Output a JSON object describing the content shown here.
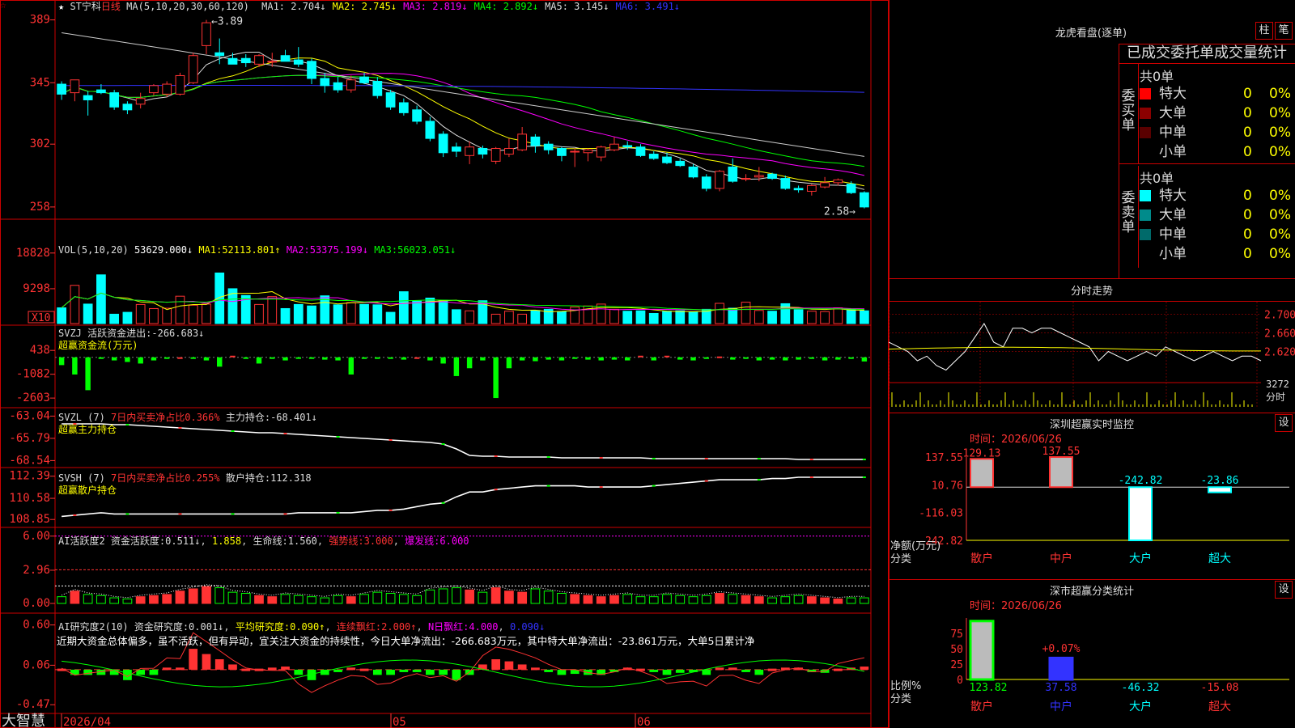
{
  "app": {
    "name": "大智慧"
  },
  "stock": {
    "star": "★",
    "arrow_glyph": "☆",
    "name": "ST宁科",
    "period": "日线",
    "ma_label": "MA(5,10,20,30,60,120)",
    "mas": [
      {
        "label": "MA1:",
        "value": "2.704↓",
        "color": "#dddddd"
      },
      {
        "label": "MA2:",
        "value": "2.745↓",
        "color": "#ffff00"
      },
      {
        "label": "MA3:",
        "value": "2.819↓",
        "color": "#ff00ff"
      },
      {
        "label": "MA4:",
        "value": "2.892↓",
        "color": "#00ff00"
      },
      {
        "label": "MA5:",
        "value": "3.145↓",
        "color": "#dddddd"
      },
      {
        "label": "MA6:",
        "value": "3.491↓",
        "color": "#3333ff"
      }
    ],
    "high_marker": "3.89",
    "low_marker": "2.58"
  },
  "axes": {
    "price": [
      "389",
      "345",
      "302",
      "258"
    ],
    "volume": [
      "18828",
      "9298",
      "X10"
    ],
    "svzj": [
      "438",
      "-1082",
      "-2603"
    ],
    "svzl": [
      "-63.04",
      "-65.79",
      "-68.54"
    ],
    "svsh": [
      "112.39",
      "110.58",
      "108.85"
    ],
    "ai1": [
      "6.00",
      "2.96",
      "0.00"
    ],
    "ai2": [
      "0.60",
      "0.06",
      "-0.47"
    ],
    "dates": [
      "2026/04",
      "05",
      "06"
    ]
  },
  "chart_data": [
    {
      "type": "candlestick",
      "title": "ST宁科 日线",
      "ylim": [
        2.5,
        3.95
      ],
      "yticks": [
        3.89,
        3.45,
        3.02,
        2.58
      ],
      "note": "approximate",
      "candles": [
        [
          3.44,
          3.46,
          3.33,
          3.37
        ],
        [
          3.38,
          3.47,
          3.32,
          3.47
        ],
        [
          3.36,
          3.39,
          3.22,
          3.33
        ],
        [
          3.4,
          3.44,
          3.37,
          3.38
        ],
        [
          3.38,
          3.4,
          3.26,
          3.28
        ],
        [
          3.3,
          3.32,
          3.23,
          3.26
        ],
        [
          3.3,
          3.38,
          3.27,
          3.34
        ],
        [
          3.38,
          3.44,
          3.36,
          3.43
        ],
        [
          3.37,
          3.46,
          3.35,
          3.44
        ],
        [
          3.37,
          3.52,
          3.36,
          3.5
        ],
        [
          3.45,
          3.66,
          3.44,
          3.64
        ],
        [
          3.71,
          3.89,
          3.65,
          3.87
        ],
        [
          3.66,
          3.76,
          3.58,
          3.64
        ],
        [
          3.62,
          3.66,
          3.58,
          3.58
        ],
        [
          3.62,
          3.65,
          3.56,
          3.59
        ],
        [
          3.58,
          3.65,
          3.56,
          3.64
        ],
        [
          3.6,
          3.66,
          3.56,
          3.6
        ],
        [
          3.64,
          3.68,
          3.6,
          3.6
        ],
        [
          3.61,
          3.7,
          3.56,
          3.58
        ],
        [
          3.6,
          3.62,
          3.44,
          3.48
        ],
        [
          3.48,
          3.52,
          3.38,
          3.43
        ],
        [
          3.45,
          3.49,
          3.38,
          3.4
        ],
        [
          3.4,
          3.5,
          3.38,
          3.47
        ],
        [
          3.49,
          3.52,
          3.44,
          3.45
        ],
        [
          3.46,
          3.49,
          3.34,
          3.36
        ],
        [
          3.38,
          3.4,
          3.26,
          3.28
        ],
        [
          3.31,
          3.34,
          3.22,
          3.24
        ],
        [
          3.26,
          3.29,
          3.16,
          3.18
        ],
        [
          3.18,
          3.21,
          3.04,
          3.06
        ],
        [
          3.09,
          3.11,
          2.93,
          2.96
        ],
        [
          3.0,
          3.03,
          2.93,
          2.97
        ],
        [
          2.94,
          3.04,
          2.88,
          3.0
        ],
        [
          2.99,
          3.01,
          2.92,
          2.95
        ],
        [
          2.9,
          3.0,
          2.88,
          2.99
        ],
        [
          2.95,
          3.06,
          2.93,
          2.99
        ],
        [
          2.98,
          3.14,
          2.97,
          3.09
        ],
        [
          3.07,
          3.09,
          2.96,
          3.01
        ],
        [
          3.02,
          3.04,
          2.95,
          2.98
        ],
        [
          2.99,
          3.0,
          2.9,
          2.94
        ],
        [
          2.97,
          2.99,
          2.86,
          2.97
        ],
        [
          2.96,
          2.99,
          2.9,
          2.98
        ],
        [
          2.93,
          3.01,
          2.9,
          3.0
        ],
        [
          2.98,
          3.07,
          2.97,
          3.02
        ],
        [
          3.01,
          3.04,
          2.98,
          3.0
        ],
        [
          3.0,
          3.02,
          2.93,
          2.94
        ],
        [
          2.95,
          2.97,
          2.91,
          2.92
        ],
        [
          2.93,
          2.96,
          2.88,
          2.89
        ],
        [
          2.9,
          2.92,
          2.86,
          2.87
        ],
        [
          2.86,
          2.88,
          2.78,
          2.79
        ],
        [
          2.79,
          2.81,
          2.69,
          2.71
        ],
        [
          2.71,
          2.84,
          2.69,
          2.83
        ],
        [
          2.86,
          2.92,
          2.75,
          2.76
        ],
        [
          2.78,
          2.81,
          2.76,
          2.78
        ],
        [
          2.79,
          2.86,
          2.76,
          2.8
        ],
        [
          2.81,
          2.82,
          2.77,
          2.78
        ],
        [
          2.78,
          2.8,
          2.7,
          2.71
        ],
        [
          2.71,
          2.73,
          2.68,
          2.7
        ],
        [
          2.69,
          2.74,
          2.66,
          2.73
        ],
        [
          2.72,
          2.79,
          2.71,
          2.75
        ],
        [
          2.75,
          2.78,
          2.73,
          2.77
        ],
        [
          2.74,
          2.76,
          2.67,
          2.68
        ],
        [
          2.68,
          2.69,
          2.57,
          2.58
        ]
      ]
    },
    {
      "type": "bar",
      "title": "VOL(5,10,20)",
      "series": [
        {
          "name": "MA1:",
          "value": "52113.801↑"
        },
        {
          "name": "MA2:",
          "value": "53375.199↓"
        },
        {
          "name": "MA3:",
          "value": "56023.051↓"
        }
      ],
      "value_label": "53629.000↓",
      "note": "approximate",
      "values": [
        4200,
        10200,
        5200,
        13000,
        2500,
        3000,
        5100,
        4000,
        4100,
        7300,
        4900,
        5200,
        13500,
        9300,
        7500,
        5100,
        7200,
        4000,
        5100,
        4700,
        7400,
        5000,
        5600,
        5100,
        5000,
        3000,
        8500,
        6000,
        6800,
        6200,
        3700,
        3400,
        6100,
        2500,
        3300,
        2500,
        3500,
        3800,
        3200,
        4400,
        4700,
        5200,
        3800,
        3300,
        3400,
        2700,
        3300,
        3400,
        3100,
        3800,
        5400,
        4100,
        5700,
        3500,
        3300,
        5300,
        3700,
        3300,
        3200,
        4200,
        3700,
        3400
      ]
    },
    {
      "type": "bar",
      "title": "SVZJ",
      "series": [
        {
          "name": "活跃资金进出:",
          "value": "-266.683↓"
        }
      ],
      "subtitle": "超赢资金流(万元)",
      "note": "approximate",
      "values": [
        -500,
        -1100,
        -2100,
        -100,
        -200,
        -300,
        -400,
        -200,
        -100,
        0,
        -100,
        -200,
        -600,
        100,
        -100,
        -400,
        -100,
        -200,
        -100,
        -100,
        -150,
        -200,
        -1100,
        -100,
        -100,
        -50,
        -150,
        0,
        -200,
        -400,
        -1200,
        -700,
        -200,
        -2600,
        -700,
        -200,
        -250,
        -150,
        -200,
        -100,
        -150,
        -200,
        -150,
        -200,
        100,
        -200,
        100,
        -150,
        -200,
        -100,
        50,
        -150,
        -100,
        -200,
        -150,
        -200,
        -150,
        -100,
        -200,
        -150,
        -100,
        -266
      ]
    },
    {
      "type": "line",
      "title": "SVZL (7)",
      "series": [
        {
          "name": "主力持仓:",
          "value": "-68.401↓"
        }
      ],
      "subtitle": "7日内买卖净占比0.366%",
      "sub2": "超赢主力持仓",
      "ylim": [
        -68.8,
        -62.8
      ],
      "note": "approximate",
      "values": [
        -64.0,
        -64.0,
        -64.0,
        -64.0,
        -64.1,
        -64.1,
        -64.2,
        -64.3,
        -64.4,
        -64.5,
        -64.6,
        -64.7,
        -64.8,
        -64.9,
        -65.0,
        -65.1,
        -65.1,
        -65.2,
        -65.3,
        -65.4,
        -65.5,
        -65.6,
        -65.7,
        -65.8,
        -65.9,
        -66.0,
        -66.1,
        -66.2,
        -66.3,
        -66.5,
        -67.1,
        -67.9,
        -68.0,
        -68.0,
        -68.1,
        -68.1,
        -68.1,
        -68.1,
        -68.2,
        -68.2,
        -68.2,
        -68.2,
        -68.2,
        -68.2,
        -68.2,
        -68.3,
        -68.3,
        -68.3,
        -68.3,
        -68.3,
        -68.3,
        -68.3,
        -68.3,
        -68.3,
        -68.3,
        -68.3,
        -68.4,
        -68.4,
        -68.4,
        -68.4,
        -68.4,
        -68.4
      ]
    },
    {
      "type": "line",
      "title": "SVSH (7)",
      "series": [
        {
          "name": "散户持仓:",
          "value": "112.318"
        }
      ],
      "subtitle": "7日内买卖净占比0.255%",
      "sub2": "超赢散户持仓",
      "ylim": [
        108.6,
        112.7
      ],
      "note": "approximate",
      "values": [
        109.1,
        109.2,
        109.3,
        109.4,
        109.3,
        109.3,
        109.3,
        109.3,
        109.3,
        109.3,
        109.3,
        109.3,
        109.3,
        109.3,
        109.3,
        109.3,
        109.3,
        109.3,
        109.4,
        109.4,
        109.4,
        109.4,
        109.4,
        109.5,
        109.6,
        109.6,
        109.7,
        109.9,
        110.1,
        110.2,
        110.7,
        111.1,
        111.1,
        111.3,
        111.4,
        111.5,
        111.6,
        111.6,
        111.6,
        111.6,
        111.5,
        111.5,
        111.5,
        111.5,
        111.5,
        111.6,
        111.7,
        111.8,
        111.9,
        112.0,
        112.1,
        112.1,
        112.1,
        112.1,
        112.2,
        112.2,
        112.3,
        112.3,
        112.3,
        112.3,
        112.3,
        112.3
      ]
    },
    {
      "type": "bar",
      "title": "AI活跃度2",
      "series": [
        {
          "name": "资金活跃度:",
          "value": "0.511↓"
        },
        {
          "name": "",
          "value": "1.858"
        },
        {
          "name": "生命线:",
          "value": "1.560"
        },
        {
          "name": "强势线:",
          "value": "3.000"
        },
        {
          "name": "爆发线:",
          "value": "6.000"
        }
      ],
      "ylim": [
        0,
        6.2
      ],
      "note": "approximate",
      "values": [
        0.6,
        1.1,
        0.8,
        0.7,
        0.5,
        0.4,
        0.6,
        0.7,
        0.8,
        1.1,
        1.3,
        1.5,
        1.4,
        1.0,
        0.9,
        0.7,
        0.6,
        0.8,
        0.7,
        0.6,
        0.5,
        0.7,
        0.6,
        0.8,
        1.0,
        0.9,
        0.8,
        0.7,
        1.2,
        1.3,
        1.4,
        1.2,
        1.0,
        1.4,
        1.1,
        1.0,
        1.3,
        1.1,
        0.9,
        0.8,
        0.7,
        0.6,
        0.7,
        0.8,
        0.6,
        0.6,
        0.8,
        0.7,
        0.6,
        0.7,
        0.9,
        0.8,
        0.7,
        0.6,
        0.5,
        0.6,
        0.7,
        0.6,
        0.5,
        0.4,
        0.5,
        0.5
      ]
    },
    {
      "type": "bar",
      "title": "AI研究度2(10)",
      "series": [
        {
          "name": "资金研究度:",
          "value": "0.001↓"
        },
        {
          "name": "平均研究度:",
          "value": "0.090↑"
        },
        {
          "name": "连续飘红:",
          "value": "2.000↑"
        },
        {
          "name": "N日飘红:",
          "value": "4.000"
        },
        {
          "name": "",
          "value": "0.090↓"
        }
      ],
      "ylim": [
        -0.5,
        0.65
      ],
      "note": "approximate",
      "values": [
        0.01,
        -0.05,
        -0.05,
        -0.05,
        -0.05,
        -0.1,
        -0.05,
        -0.05,
        0.02,
        0.02,
        0.2,
        0.15,
        0.1,
        0.05,
        0.01,
        0.01,
        0.02,
        0.03,
        -0.05,
        -0.1,
        -0.05,
        -0.01,
        0.02,
        0.01,
        -0.05,
        -0.05,
        -0.02,
        -0.01,
        -0.05,
        -0.05,
        -0.1,
        -0.05,
        0.05,
        0.1,
        0.08,
        0.05,
        0.02,
        -0.02,
        -0.05,
        -0.04,
        -0.05,
        -0.05,
        -0.02,
        0.02,
        0.01,
        -0.01,
        -0.05,
        -0.03,
        -0.02,
        -0.05,
        0.02,
        0.02,
        -0.02,
        -0.05,
        0.01,
        0.02,
        0.02,
        -0.02,
        -0.03,
        0.01,
        0.02,
        0.03
      ]
    },
    {
      "type": "line",
      "title": "分时走势",
      "ylim": [
        2.56,
        2.72
      ],
      "yticks": [
        "2.700",
        "2.660",
        "2.620"
      ],
      "vol_label": "3272",
      "unit_label": "分时",
      "note": "approximate",
      "values": [
        2.64,
        2.63,
        2.62,
        2.6,
        2.61,
        2.59,
        2.58,
        2.6,
        2.62,
        2.65,
        2.68,
        2.64,
        2.63,
        2.67,
        2.67,
        2.66,
        2.67,
        2.67,
        2.66,
        2.65,
        2.64,
        2.63,
        2.6,
        2.62,
        2.61,
        2.6,
        2.61,
        2.62,
        2.61,
        2.63,
        2.62,
        2.61,
        2.6,
        2.61,
        2.62,
        2.61,
        2.6,
        2.61,
        2.61,
        2.6
      ]
    },
    {
      "type": "bar",
      "title": "深圳超赢实时监控",
      "date_label": "时间：2026/06/26",
      "yticks": [
        "137.55",
        "10.76",
        "-116.03",
        "-242.82"
      ],
      "ylabel": "净额(万元)",
      "xlabel": "分类",
      "categories": [
        "散户",
        "中户",
        "大户",
        "超大"
      ],
      "values": [
        129.13,
        137.55,
        -242.82,
        -23.86
      ],
      "value_labels": [
        "129.13",
        "137.55",
        "-242.82",
        "-23.86"
      ]
    },
    {
      "type": "bar",
      "title": "深市超赢分类统计",
      "date_label": "时间：2026/06/26",
      "yticks": [
        "75",
        "50",
        "25",
        "0"
      ],
      "ylabel": "比例%",
      "xlabel": "分类",
      "categories": [
        "散户",
        "中户",
        "大户",
        "超大"
      ],
      "values": [
        95,
        35,
        0,
        0
      ],
      "value_labels": [
        "123.82",
        "37.58",
        "-46.32",
        "-15.08"
      ],
      "annotation": "+0.07%"
    }
  ],
  "dragon": {
    "title": "龙虎看盘(逐单)",
    "btn1": "柱",
    "btn2": "笔",
    "table_title": "已成交委托单成交量统计",
    "buy": {
      "label": "委买单",
      "count": "共0单",
      "rows": [
        {
          "name": "特大",
          "count": "0",
          "pct": "0%",
          "color": "#ff0000"
        },
        {
          "name": "大单",
          "count": "0",
          "pct": "0%",
          "color": "#8b0000"
        },
        {
          "name": "中单",
          "count": "0",
          "pct": "0%",
          "color": "#5a0000"
        },
        {
          "name": "小单",
          "count": "0",
          "pct": "0%",
          "color": "#000000"
        }
      ]
    },
    "sell": {
      "label": "委卖单",
      "count": "共0单",
      "rows": [
        {
          "name": "特大",
          "count": "0",
          "pct": "0%",
          "color": "#00ffff"
        },
        {
          "name": "大单",
          "count": "0",
          "pct": "0%",
          "color": "#008b8b"
        },
        {
          "name": "中单",
          "count": "0",
          "pct": "0%",
          "color": "#006a6a"
        },
        {
          "name": "小单",
          "count": "0",
          "pct": "0%",
          "color": "#000000"
        }
      ]
    }
  },
  "panels": {
    "svzj_title": "SVZJ",
    "commentary": "近期大资金总体偏多，虽不活跃，但有异动，宜关注大资金的持续性，今日大单净流出：-266.683万元，其中特大单净流出：-23.861万元，大单5日累计净",
    "monitor_set": "设",
    "stat_set": "设"
  }
}
